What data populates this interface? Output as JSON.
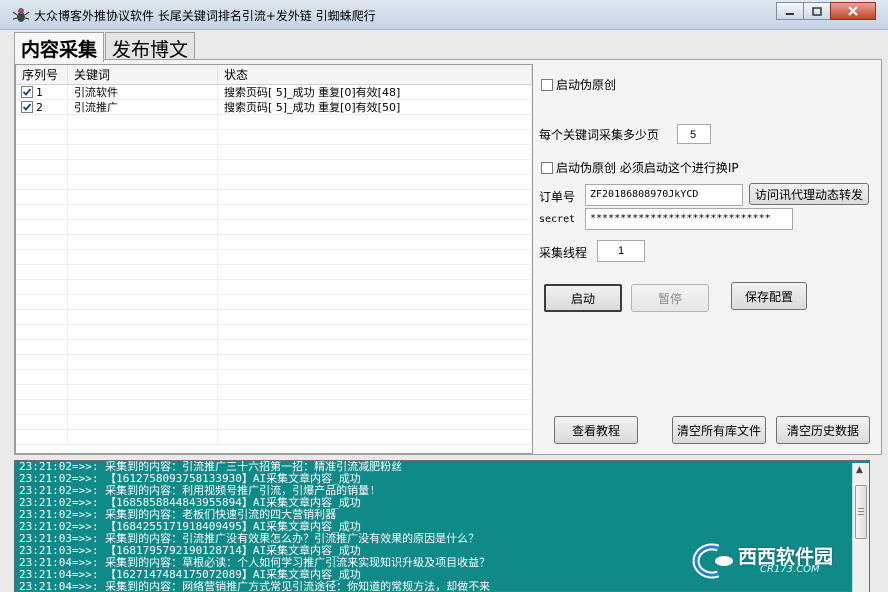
{
  "window": {
    "title": "大众博客外推协议软件 长尾关键词排名引流+发外链 引蜘蛛爬行",
    "icon": "spider-app-icon"
  },
  "tabs": [
    {
      "label": "内容采集",
      "active": true
    },
    {
      "label": "发布博文",
      "active": false
    }
  ],
  "grid": {
    "headers": [
      "序列号",
      "关键词",
      "状态"
    ],
    "rows": [
      {
        "checked": true,
        "index": "1",
        "keyword": "引流软件",
        "status": "搜索页码[ 5]_成功 重复[0]有效[48]"
      },
      {
        "checked": true,
        "index": "2",
        "keyword": "引流推广",
        "status": "搜索页码[ 5]_成功 重复[0]有效[50]"
      }
    ]
  },
  "options": {
    "pseudo_original_label": "启动伪原创",
    "pseudo_original_checked": false,
    "pages_label": "每个关键词采集多少页",
    "pages_value": "5",
    "pseudo_original_ip_label": "启动伪原创 必须启动这个进行换IP",
    "pseudo_original_ip_checked": false,
    "order_label": "订单号",
    "order_value": "ZF20186808970JkYCD",
    "proxy_button": "访问讯代理动态转发",
    "secret_label": "secret",
    "secret_value": "******************************",
    "threads_label": "采集线程",
    "threads_value": "1"
  },
  "buttons": {
    "start": "启动",
    "pause": "暂停",
    "save": "保存配置",
    "tutorial": "查看教程",
    "clear_files": "清空所有库文件",
    "clear_history": "清空历史数据"
  },
  "log_lines": [
    "23:21:02=>>: 采集到的内容：引流推广三十六招第一招：精准引流减肥粉丝",
    "23:21:02=>>: 【1612758093758133930】AI采集文章内容_成功",
    "23:21:02=>>: 采集到的内容：利用视频号推广引流，引爆产品的销量!",
    "23:21:02=>>: 【1685858844843955894】AI采集文章内容_成功",
    "23:21:02=>>: 采集到的内容：老板们快速引流的四大营销利器",
    "23:21:02=>>: 【1684255171918409495】AI采集文章内容_成功",
    "23:21:03=>>: 采集到的内容：引流推广没有效果怎么办？引流推广没有效果的原因是什么？",
    "23:21:03=>>: 【1681795792190128714】AI采集文章内容_成功",
    "23:21:04=>>: 采集到的内容：草根必读：个人如何学习推广引流来实现知识升级及项目收益？",
    "23:21:04=>>: 【1627147484175072089】AI采集文章内容_成功",
    "23:21:04=>>: 采集到的内容：网络营销推广方式常见引流途径：你知道的常规方法，却做不来"
  ],
  "watermark": {
    "text": "西西软件园",
    "sub": "CR173.COM"
  },
  "colors": {
    "log_background": "#0f8a89",
    "title_gradient_top": "#dfe7f1",
    "close_button": "#c3432c"
  }
}
